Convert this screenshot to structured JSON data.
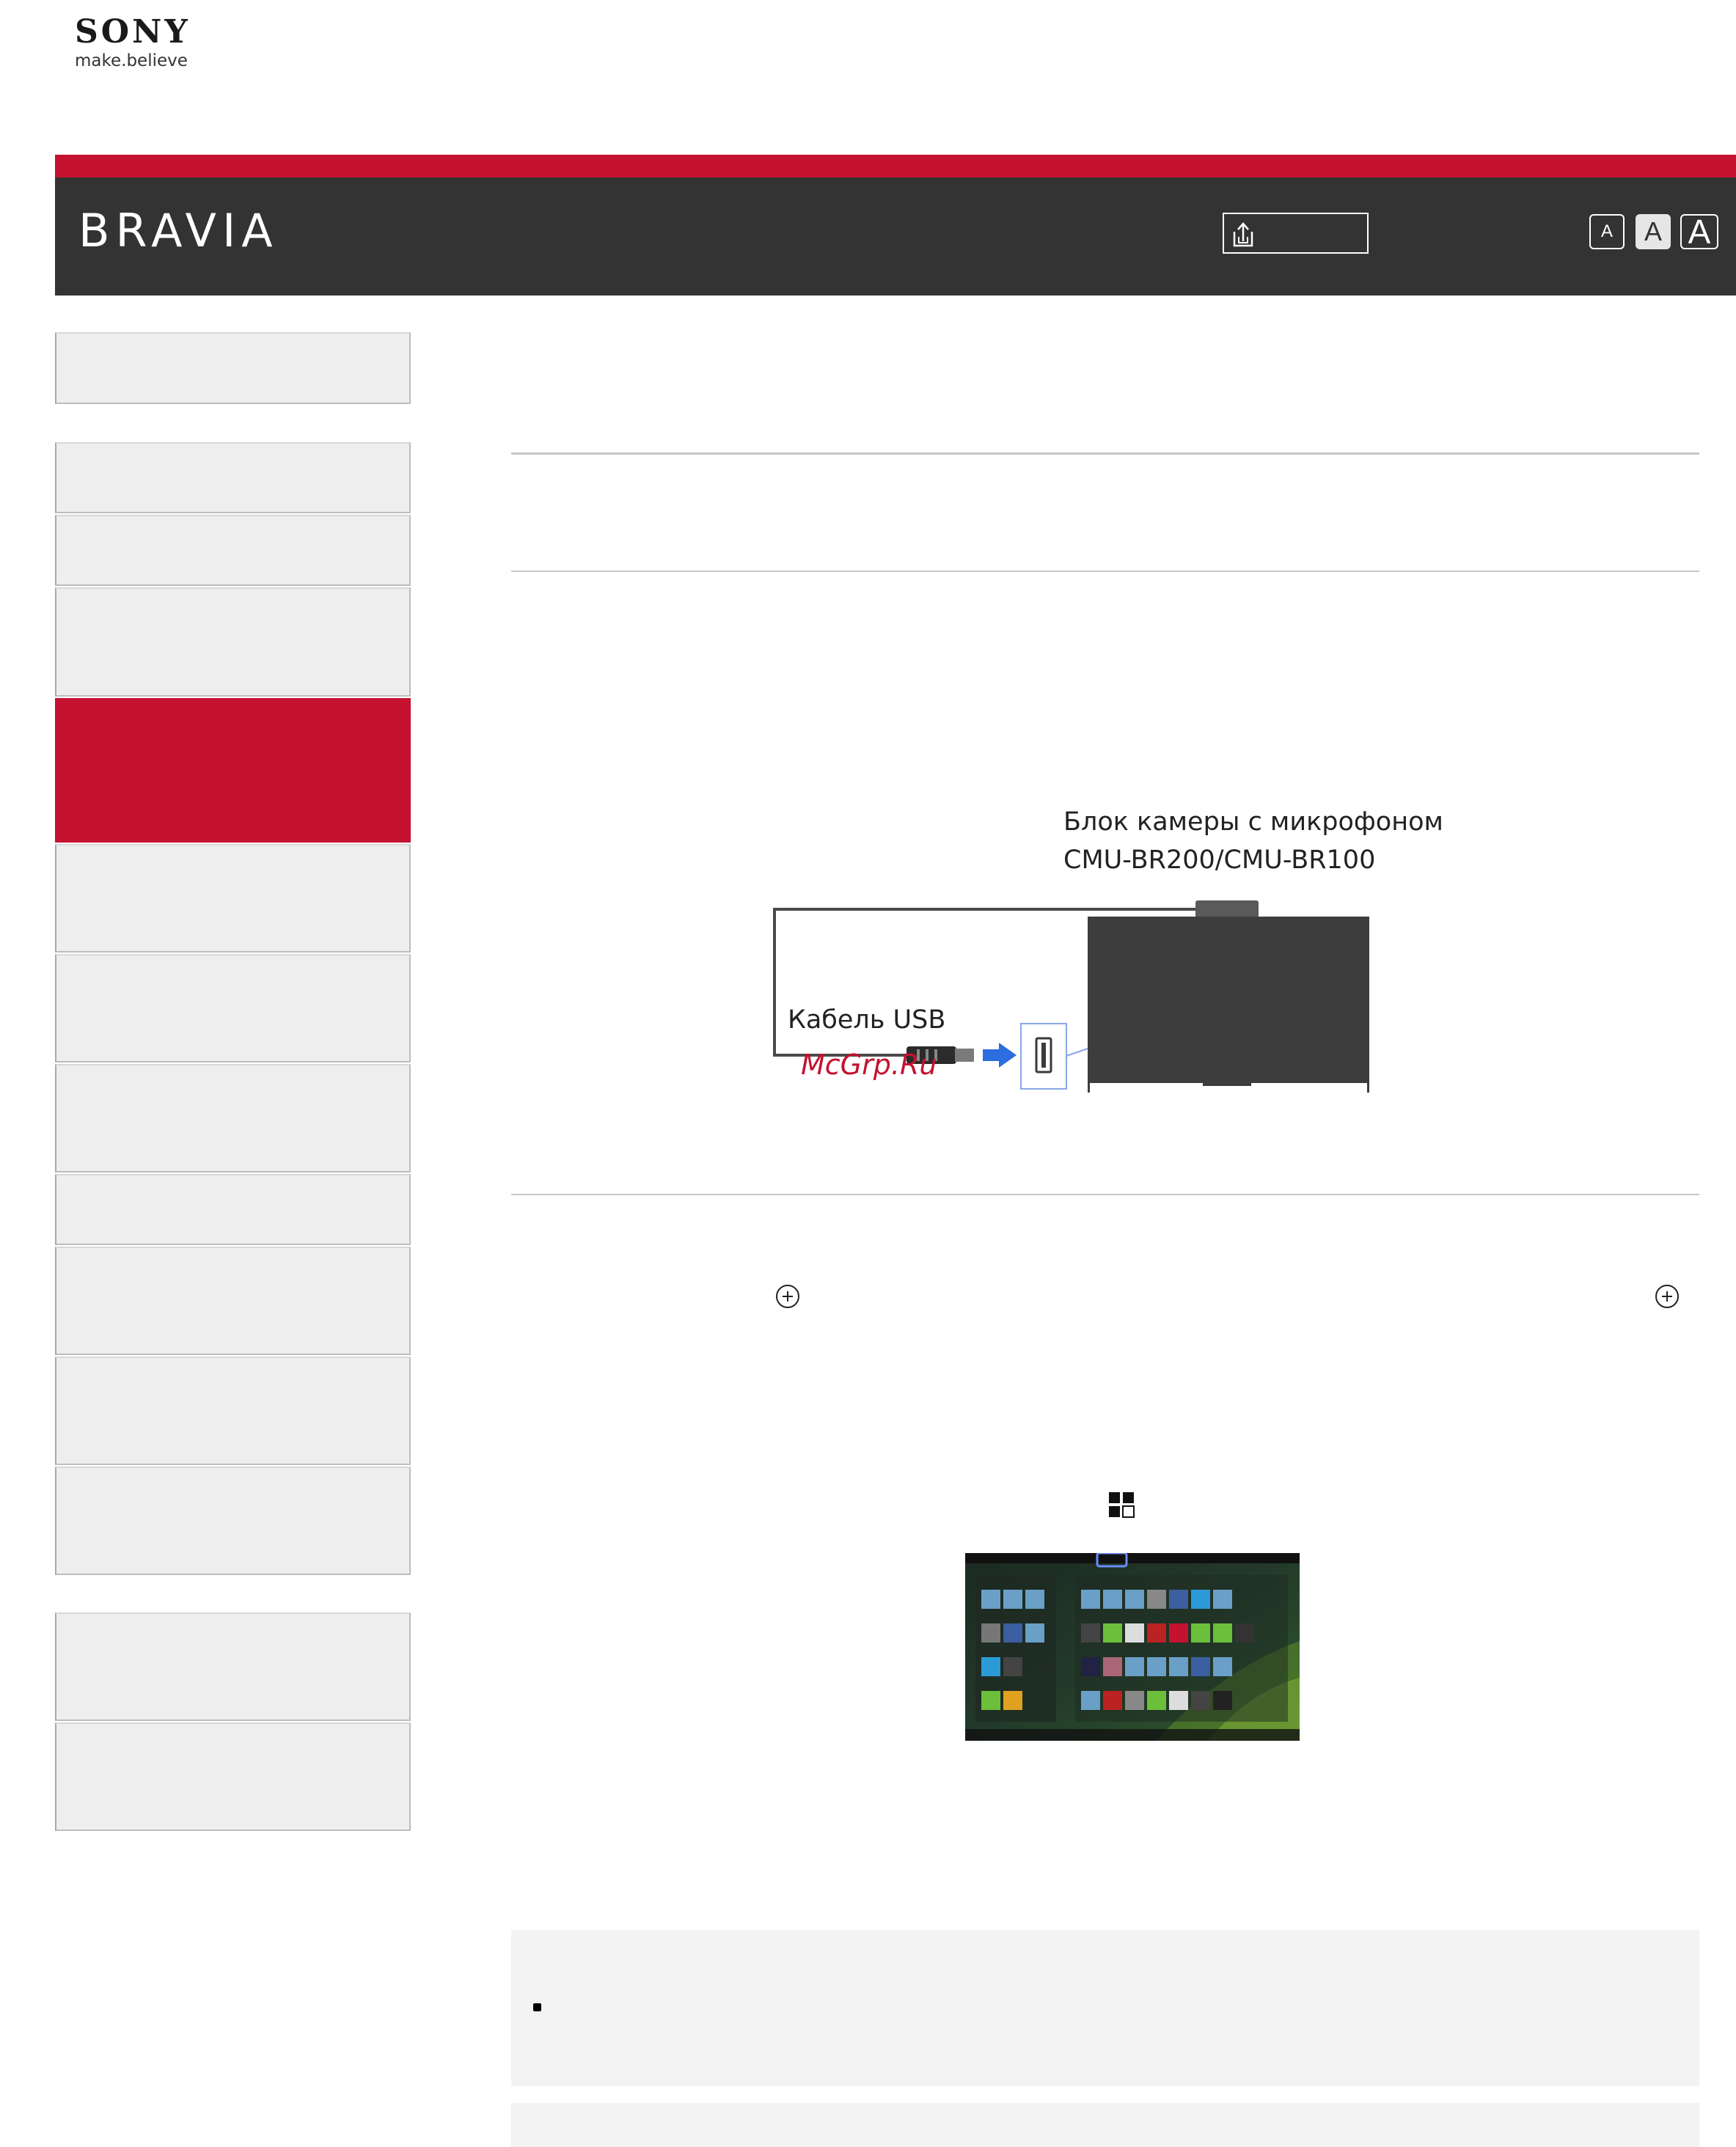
{
  "brand": {
    "company": "SONY",
    "tagline": "make.believe",
    "product": "BRAVIA",
    "accent_color": "#c41230",
    "header_color": "#333333"
  },
  "header": {
    "share_icon": "share-icon",
    "font_size_buttons": [
      "A",
      "A",
      "A"
    ]
  },
  "sidebar": {
    "items": [
      {
        "label": "",
        "active": false
      },
      {
        "label": "",
        "active": false
      },
      {
        "label": "",
        "active": false
      },
      {
        "label": "",
        "active": false
      },
      {
        "label": "",
        "active": true
      },
      {
        "label": "",
        "active": false
      },
      {
        "label": "",
        "active": false
      },
      {
        "label": "",
        "active": false
      },
      {
        "label": "",
        "active": false
      },
      {
        "label": "",
        "active": false
      },
      {
        "label": "",
        "active": false
      },
      {
        "label": "",
        "active": false
      },
      {
        "label": "",
        "active": false
      },
      {
        "label": "",
        "active": false
      }
    ]
  },
  "diagram": {
    "camera_label_line1": "Блок камеры с микрофоном",
    "camera_label_line2": "CMU-BR200/CMU-BR100",
    "cable_label": "Кабель USB",
    "watermark": "McGrp.Ru"
  },
  "steps": {
    "select_icon": "enter-button-icon",
    "apps_icon": "apps-icon"
  }
}
